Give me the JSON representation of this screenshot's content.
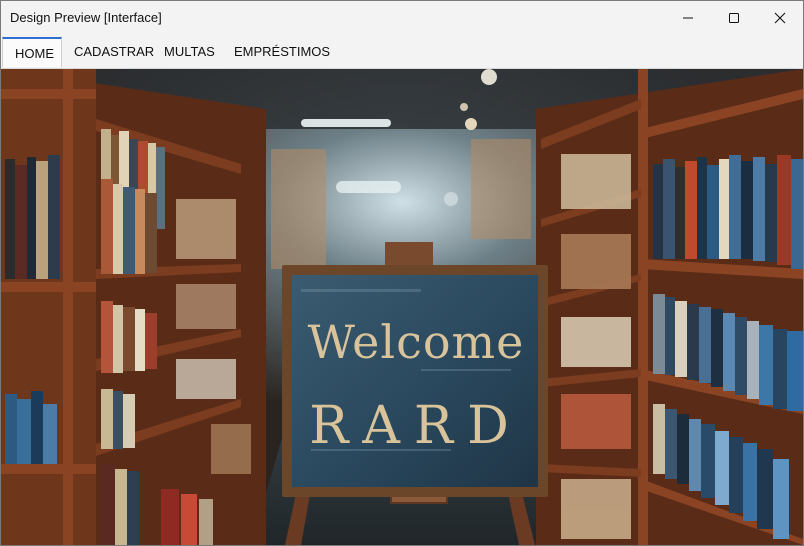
{
  "window": {
    "title": "Design Preview [Interface]",
    "controls": [
      "minimize-icon",
      "maximize-icon",
      "close-icon"
    ]
  },
  "tabs": [
    {
      "label": "HOME",
      "active": true
    },
    {
      "label": "CADASTRAR",
      "active": false
    },
    {
      "label": "MULTAS",
      "active": false
    },
    {
      "label": "EMPRÉSTIMOS",
      "active": false
    }
  ],
  "hero": {
    "sign_line1": "Welcome",
    "sign_line2": "RARD"
  },
  "colors": {
    "accent": "#2f6fd4",
    "sign_board": "#2b4a60",
    "sign_text": "#d8c39a",
    "shelf_wood": "#7a3a1e"
  }
}
